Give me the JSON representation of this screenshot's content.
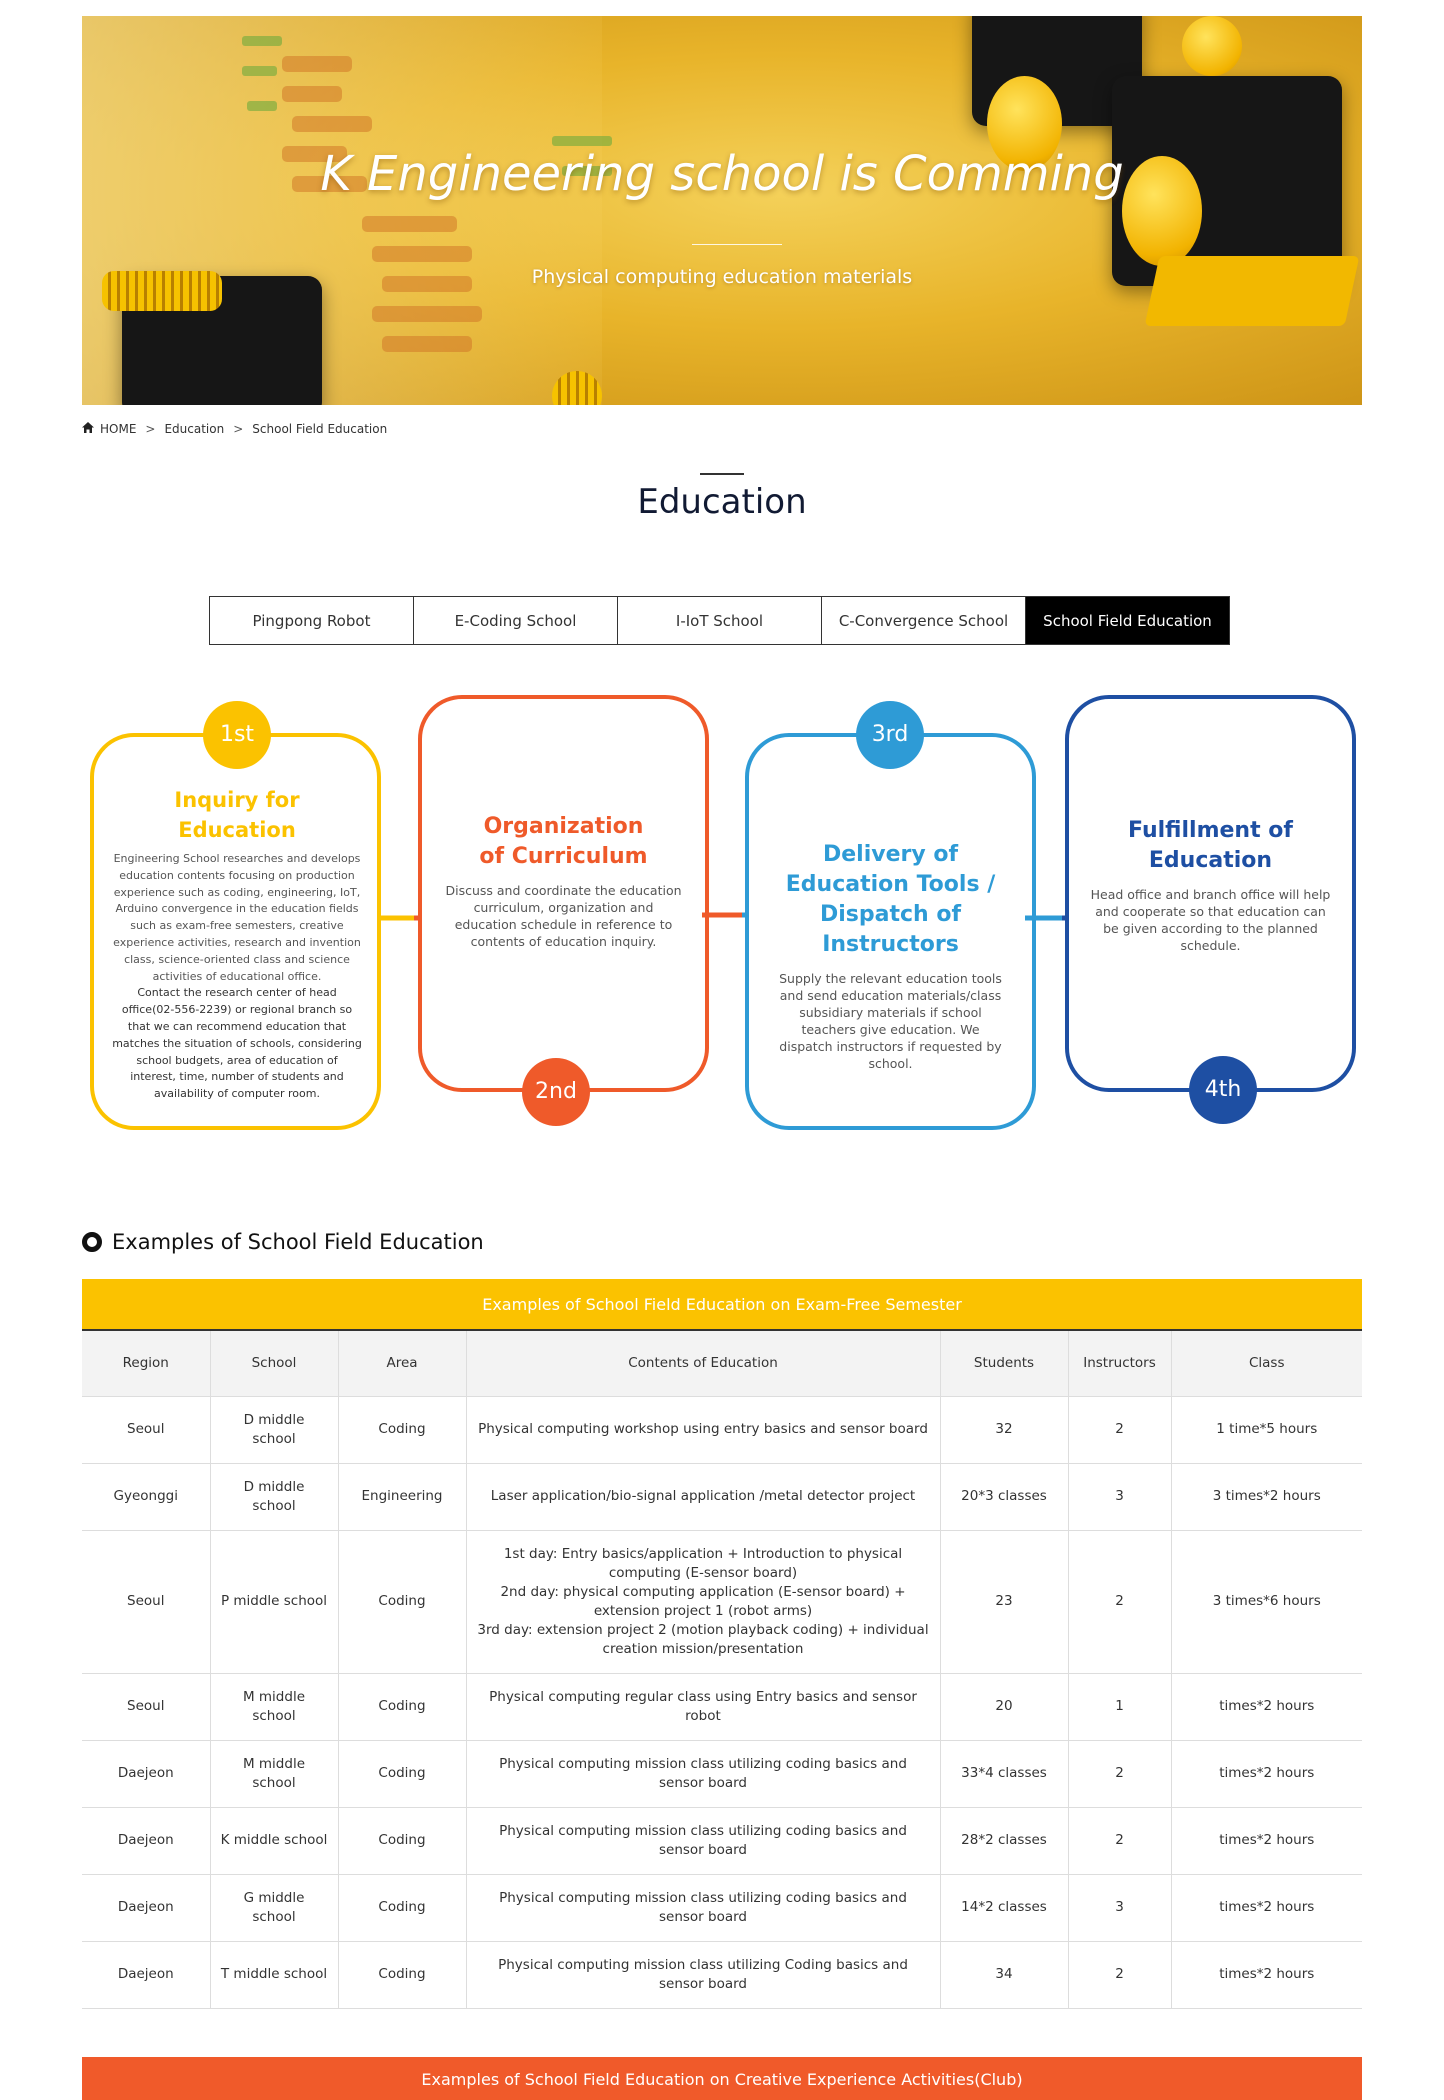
{
  "banner": {
    "title": "K Engineering school is Comming",
    "subtitle": "Physical computing education materials"
  },
  "breadcrumb": {
    "home": "HOME",
    "items": [
      "Education",
      "School Field Education"
    ]
  },
  "page": {
    "title": "Education"
  },
  "tabs": [
    {
      "label": "Pingpong Robot",
      "active": false
    },
    {
      "label": "E-Coding School",
      "active": false
    },
    {
      "label": "I-IoT School",
      "active": false
    },
    {
      "label": "C-Convergence School",
      "active": false
    },
    {
      "label": "School Field Education",
      "active": true
    }
  ],
  "process": {
    "colors": {
      "step1": "#fbc200",
      "step2": "#ef5a2a",
      "step3": "#2e9bd6",
      "step4": "#1e4fa3"
    },
    "steps": [
      {
        "badge": "1st",
        "title": "Inquiry for Education",
        "desc": "Engineering School researches and develops education contents focusing on production experience such as coding, engineering, IoT, Arduino convergence in the education fields such as exam-free semesters, creative experience activities, research and invention class, science-oriented class and science activities of educational office.",
        "desc2": "Contact the research center of head office(02-556-2239) or regional branch so that we can recommend education that matches the situation of schools, considering school budgets, area of education of interest, time, number of students and availability of computer room."
      },
      {
        "badge": "2nd",
        "title": "Organization of Curriculum",
        "desc": "Discuss and coordinate the education curriculum, organization and education schedule in reference to contents of education inquiry."
      },
      {
        "badge": "3rd",
        "title": "Delivery of Education Tools / Dispatch of Instructors",
        "desc": "Supply the relevant education tools and send education materials/class subsidiary materials if school teachers give education. We dispatch instructors if requested by school."
      },
      {
        "badge": "4th",
        "title": "Fulfillment of Education",
        "desc": "Head office and branch office will help and cooperate so that education can be given according to the planned schedule."
      }
    ]
  },
  "examples": {
    "heading": "Examples of School Field Education",
    "table1": {
      "title": "Examples of School Field Education on Exam-Free Semester",
      "headers": [
        "Region",
        "School",
        "Area",
        "Contents of Education",
        "Students",
        "Instructors",
        "Class"
      ],
      "rows": [
        [
          "Seoul",
          "D middle school",
          "Coding",
          "Physical computing workshop using entry basics and sensor board",
          "32",
          "2",
          "1 time*5 hours"
        ],
        [
          "Gyeonggi",
          "D middle school",
          "Engineering",
          "Laser application/bio-signal application /metal detector project",
          "20*3 classes",
          "3",
          "3 times*2 hours"
        ],
        [
          "Seoul",
          "P middle school",
          "Coding",
          "1st day: Entry basics/application + Introduction to physical computing (E-sensor board)\n2nd day: physical computing application (E-sensor board) + extension project 1 (robot arms)\n3rd day: extension project 2 (motion playback coding) + individual creation mission/presentation",
          "23",
          "2",
          "3 times*6 hours"
        ],
        [
          "Seoul",
          "M middle school",
          "Coding",
          "Physical computing regular class using Entry basics and sensor robot",
          "20",
          "1",
          "times*2 hours"
        ],
        [
          "Daejeon",
          "M middle school",
          "Coding",
          "Physical computing mission class utilizing coding basics and sensor board",
          "33*4 classes",
          "2",
          "times*2 hours"
        ],
        [
          "Daejeon",
          "K middle school",
          "Coding",
          "Physical computing mission class utilizing coding basics and sensor board",
          "28*2 classes",
          "2",
          "times*2 hours"
        ],
        [
          "Daejeon",
          "G middle school",
          "Coding",
          "Physical computing mission class utilizing coding basics and sensor board",
          "14*2 classes",
          "3",
          "times*2 hours"
        ],
        [
          "Daejeon",
          "T middle school",
          "Coding",
          "Physical computing mission class utilizing Coding basics and sensor board",
          "34",
          "2",
          "times*2 hours"
        ]
      ]
    },
    "table2": {
      "title": "Examples of School Field Education on Creative Experience Activities(Club)"
    }
  }
}
